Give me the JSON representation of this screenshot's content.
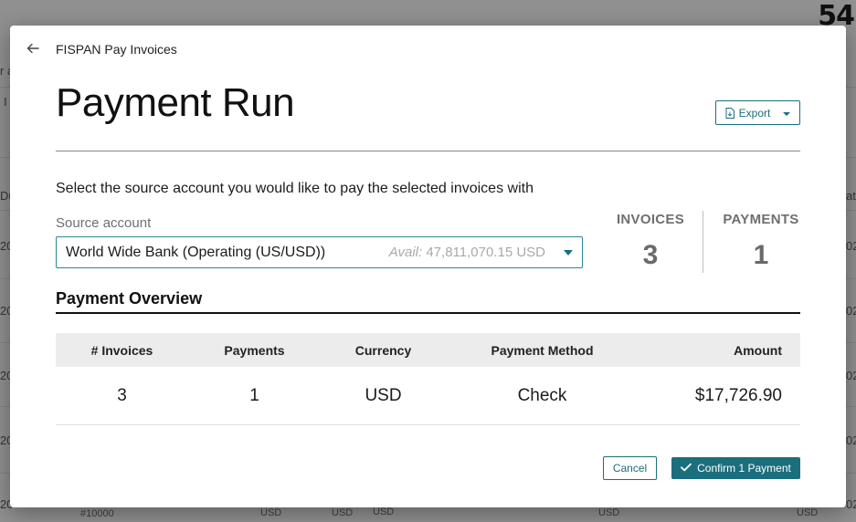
{
  "background": {
    "corner_text": "54",
    "fragments": [
      "#10000",
      "USD",
      "USD",
      "USD",
      "USD",
      "USD"
    ],
    "edge_fragments_left": [
      "r a",
      "I",
      "Du",
      "20",
      "20",
      "20",
      "20",
      "20",
      "20"
    ],
    "edge_fragments_right": [
      "ate",
      "023",
      "023",
      "023",
      "023",
      "023",
      "023"
    ]
  },
  "modal": {
    "app_title": "FISPAN Pay Invoices",
    "page_title": "Payment Run",
    "export_label": "Export",
    "instruction": "Select the source account you would like to pay the selected invoices with",
    "source_account": {
      "label": "Source account",
      "value": "World Wide Bank (Operating (US/USD))",
      "avail_label": "Avail:",
      "avail_amount": "47,811,070.15 USD"
    },
    "stats": {
      "invoices_label": "INVOICES",
      "invoices_value": "3",
      "payments_label": "PAYMENTS",
      "payments_value": "1"
    },
    "overview": {
      "title": "Payment Overview",
      "columns": [
        "# Invoices",
        "Payments",
        "Currency",
        "Payment Method",
        "Amount"
      ],
      "rows": [
        [
          "3",
          "1",
          "USD",
          "Check",
          "$17,726.90"
        ]
      ]
    },
    "cancel_label": "Cancel",
    "confirm_label": "Confirm 1 Payment"
  },
  "colors": {
    "accent": "#1a6e7d",
    "muted_text": "#6f6f6f"
  }
}
